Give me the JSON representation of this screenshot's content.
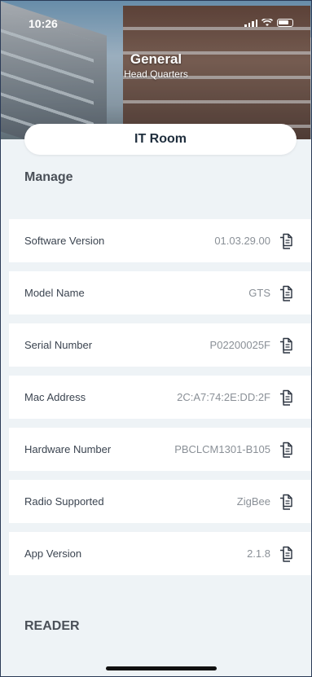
{
  "status_bar": {
    "time": "10:26"
  },
  "header": {
    "title": "General",
    "subtitle": "Head Quarters"
  },
  "room": {
    "name": "IT Room"
  },
  "manage_section": {
    "title": "Manage"
  },
  "info_rows": [
    {
      "label": "Software Version",
      "value": "01.03.29.00",
      "icon": "copy-icon"
    },
    {
      "label": "Model Name",
      "value": "GTS",
      "icon": "copy-icon"
    },
    {
      "label": "Serial Number",
      "value": "P02200025F",
      "icon": "copy-icon"
    },
    {
      "label": "Mac Address",
      "value": "2C:A7:74:2E:DD:2F",
      "icon": "copy-icon"
    },
    {
      "label": "Hardware Number",
      "value": "PBCLCM1301-B105",
      "icon": "copy-icon"
    },
    {
      "label": "Radio Supported",
      "value": "ZigBee",
      "icon": "copy-icon"
    },
    {
      "label": "App Version",
      "value": "2.1.8",
      "icon": "copy-icon"
    }
  ],
  "reader_section": {
    "title": "READER"
  },
  "colors": {
    "accent_text": "#1f2e3d",
    "background": "#eef3f6",
    "border": "#2b3b57"
  }
}
